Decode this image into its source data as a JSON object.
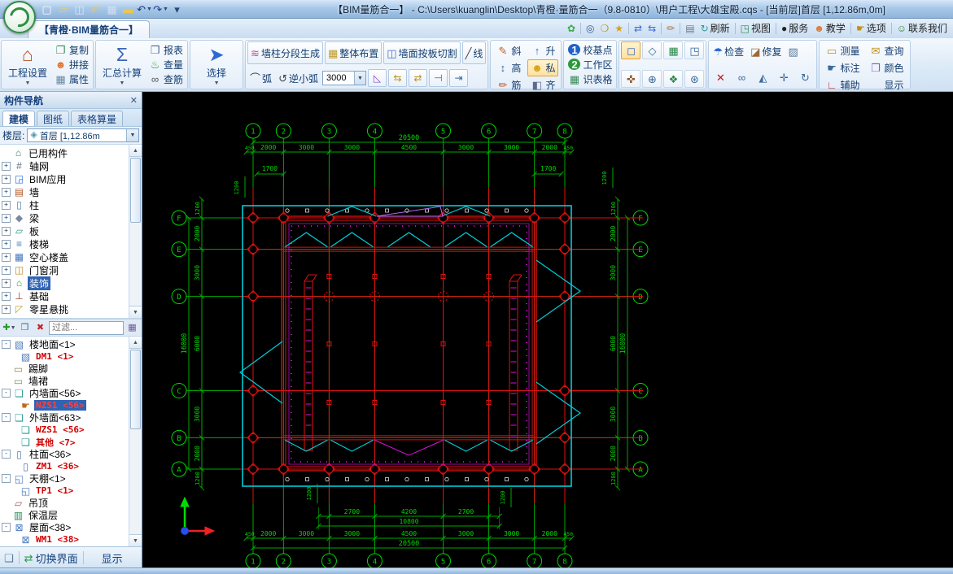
{
  "titlebar": {
    "title": "【BIM量筋合一】 - C:\\Users\\kuanglin\\Desktop\\青橙·量筋合一（9.8-0810）\\用户工程\\大雄宝殿.cqs - [当前层]首层 [1,12.86m,0m]",
    "items": [
      {
        "icon": "tnew"
      },
      {
        "icon": "topen"
      },
      {
        "icon": "tsave"
      },
      {
        "icon": "treport"
      },
      {
        "icon": "tgrid"
      },
      {
        "icon": "truler"
      },
      {
        "icon": "undo",
        "dd": true
      },
      {
        "icon": "redo",
        "dd": true
      },
      {
        "icon": "tmore"
      }
    ]
  },
  "ribbon": {
    "tab": "【青橙·BIM量筋合一】",
    "quickbar": [
      {
        "icon": "flower"
      },
      {
        "sep": true
      },
      {
        "icon": "find"
      },
      {
        "icon": "findf"
      },
      {
        "icon": "findg"
      },
      {
        "sep": true
      },
      {
        "icon": "swapa"
      },
      {
        "icon": "swapb"
      },
      {
        "sep": true
      },
      {
        "icon": "brush"
      },
      {
        "sep": true
      },
      {
        "icon": "kbd"
      },
      {
        "icon": "refresh",
        "label": "刷新"
      },
      {
        "sep": true
      },
      {
        "icon": "tv",
        "label": "视图"
      },
      {
        "sep": true
      },
      {
        "icon": "qq",
        "label": "服务"
      },
      {
        "icon": "teach",
        "label": "教学"
      },
      {
        "sep": true
      },
      {
        "icon": "opts",
        "label": "选项"
      },
      {
        "sep": true
      },
      {
        "icon": "contact",
        "label": "联系我们"
      }
    ],
    "groups": [
      {
        "t": "bigstack",
        "big": {
          "icon": "house",
          "label": "工程设置"
        },
        "stack": [
          {
            "icon": "copy",
            "label": "复制"
          },
          {
            "icon": "people2",
            "label": "拼接"
          },
          {
            "icon": "props",
            "label": "属性"
          }
        ]
      },
      {
        "t": "bigstack",
        "big": {
          "icon": "sigma",
          "label": "汇总计算"
        },
        "stack": [
          {
            "icon": "report",
            "label": "报表"
          },
          {
            "icon": "teapot",
            "label": "查量"
          },
          {
            "icon": "glasses",
            "label": "查筋"
          }
        ]
      },
      {
        "t": "big",
        "big": {
          "icon": "cursor",
          "label": "选择"
        }
      },
      {
        "t": "wall",
        "row1": [
          {
            "icon": "wallgen",
            "label": "墙柱分段生成"
          },
          {
            "icon": "layout",
            "label": "整体布置"
          },
          {
            "icon": "cutwall",
            "label": "墙面按板切割"
          },
          {
            "icon": "line",
            "label": "线"
          }
        ],
        "row2": [
          {
            "icon": "arc",
            "label": "弧"
          },
          {
            "icon": "arcr",
            "label": "逆小弧"
          }
        ],
        "combo": "3000",
        "tools": [
          "tri",
          "pairL",
          "pairR",
          "ext1",
          "ext2"
        ]
      },
      {
        "t": "grid",
        "items": [
          {
            "icon": "pencil",
            "label": "斜"
          },
          {
            "icon": "up",
            "label": "升"
          },
          {
            "icon": "height",
            "label": "高"
          },
          {
            "icon": "person",
            "label": "私",
            "hl": true
          },
          {
            "icon": "rebar",
            "label": "筋"
          },
          {
            "icon": "align",
            "label": "齐"
          }
        ]
      },
      {
        "t": "stack",
        "items": [
          {
            "icon": "b1",
            "label": "校基点"
          },
          {
            "icon": "b2",
            "label": "工作区"
          },
          {
            "icon": "table",
            "label": "识表格"
          }
        ]
      },
      {
        "t": "views",
        "row1": [
          {
            "icon": "v2d",
            "hl": true
          },
          {
            "icon": "v3d"
          },
          {
            "icon": "vbuild"
          },
          {
            "icon": "vbox"
          }
        ],
        "row2": [
          {
            "icon": "hand2"
          },
          {
            "icon": "zoompm"
          },
          {
            "icon": "pin"
          },
          {
            "icon": "zoomext"
          }
        ]
      },
      {
        "t": "fix",
        "row1": [
          {
            "icon": "umbrella",
            "label": "检查"
          },
          {
            "icon": "fix",
            "label": "修复"
          },
          {
            "icon": "fix2"
          }
        ],
        "row2": [
          {
            "icon": "del"
          },
          {
            "icon": "chain"
          },
          {
            "icon": "mirror"
          },
          {
            "icon": "move"
          },
          {
            "icon": "rotate"
          }
        ]
      },
      {
        "t": "grid",
        "items": [
          {
            "icon": "ruler2",
            "label": "测量"
          },
          {
            "icon": "query",
            "label": "查询"
          },
          {
            "icon": "tag",
            "label": "标注"
          },
          {
            "icon": "colorbox",
            "label": "颜色"
          },
          {
            "icon": "axis2",
            "label": "辅助"
          },
          {
            "icon": "display",
            "label": "显示"
          }
        ]
      }
    ]
  },
  "panel": {
    "title": "构件导航",
    "close_glyph": "✕",
    "tabs": [
      "建模",
      "图纸",
      "表格算量"
    ],
    "active_tab": 0,
    "floor_label": "楼层:",
    "floor_value": "首层 [1,12.86m",
    "filter_placeholder": "过滤...",
    "tree1": [
      {
        "label": "已用构件",
        "icon": "used"
      },
      {
        "label": "轴网",
        "icon": "axes",
        "exp": "+"
      },
      {
        "label": "BIM应用",
        "icon": "bim",
        "exp": "+"
      },
      {
        "label": "墙",
        "icon": "wall",
        "exp": "+"
      },
      {
        "label": "柱",
        "icon": "column",
        "exp": "+"
      },
      {
        "label": "梁",
        "icon": "beam",
        "exp": "+"
      },
      {
        "label": "板",
        "icon": "slab",
        "exp": "+"
      },
      {
        "label": "楼梯",
        "icon": "stairs",
        "exp": "+"
      },
      {
        "label": "空心楼盖",
        "icon": "hollow",
        "exp": "+"
      },
      {
        "label": "门窗洞",
        "icon": "opening",
        "exp": "+"
      },
      {
        "label": "装饰",
        "icon": "decor",
        "exp": "+",
        "selected": true
      },
      {
        "label": "基础",
        "icon": "foundation",
        "exp": "+"
      },
      {
        "label": "零星悬挑",
        "icon": "cantilever",
        "exp": "+"
      }
    ],
    "tree2": [
      {
        "label": "楼地面<1>",
        "icon": "floorface",
        "exp": "-"
      },
      {
        "label": "DM1 <1>",
        "icon": "floorface",
        "level": 1,
        "red": true
      },
      {
        "label": "踢脚",
        "icon": "skirting"
      },
      {
        "label": "墙裙",
        "icon": "dado"
      },
      {
        "label": "内墙面<56>",
        "icon": "wallface",
        "exp": "-"
      },
      {
        "label": "NZS1 <56>",
        "icon": "hand",
        "level": 1,
        "red": true,
        "selected": true
      },
      {
        "label": "外墙面<63>",
        "icon": "wallface",
        "exp": "-"
      },
      {
        "label": "WZS1 <56>",
        "icon": "wallface",
        "level": 1,
        "red": true
      },
      {
        "label": "其他 <7>",
        "icon": "wallface",
        "level": 1,
        "red": true
      },
      {
        "label": "柱面<36>",
        "icon": "colface",
        "exp": "-"
      },
      {
        "label": "ZM1 <36>",
        "icon": "colface",
        "level": 1,
        "red": true
      },
      {
        "label": "天棚<1>",
        "icon": "ceilface",
        "exp": "-"
      },
      {
        "label": "TP1 <1>",
        "icon": "ceilface",
        "level": 1,
        "red": true
      },
      {
        "label": "吊顶",
        "icon": "hangceil"
      },
      {
        "label": "保温层",
        "icon": "insul"
      },
      {
        "label": "屋面<38>",
        "icon": "roof",
        "exp": "-"
      },
      {
        "label": "WM1 <38>",
        "icon": "roof",
        "level": 1,
        "red": true
      }
    ],
    "bottom": [
      "切换界面",
      "显示"
    ]
  },
  "drawing": {
    "h_axis_labels": [
      "1",
      "2",
      "3",
      "4",
      "5",
      "6",
      "7",
      "8"
    ],
    "h_spans": [
      2000,
      3000,
      3000,
      4500,
      3000,
      3000,
      2000
    ],
    "h_span_labels": [
      "2000",
      "3000",
      "3000",
      "4500",
      "3000",
      "3000",
      "2000"
    ],
    "h_total": "20500",
    "h_end": "450",
    "v_axis_labels": [
      "A",
      "B",
      "C",
      "D",
      "E",
      "F"
    ],
    "v_spans": [
      2000,
      3000,
      6000,
      3000,
      2000
    ],
    "v_span_labels": [
      "2000",
      "3000",
      "6000",
      "3000",
      "2000"
    ],
    "v_total": "16000",
    "v_edge": "1200",
    "sub_labels": [
      "2700",
      "4200",
      "2700"
    ],
    "sub_total": "10800",
    "porch_dim": "1700",
    "offset_dim": "1200",
    "colors": {
      "grid": "#00a800",
      "text": "#00d800",
      "red": "#e01010",
      "cyan": "#00ccd8",
      "magenta": "#d812d8",
      "white": "#dedede"
    }
  },
  "icons": {
    "tnew": {
      "g": "▢",
      "c": "#f8fbff"
    },
    "topen": {
      "g": "▱",
      "c": "#eec860"
    },
    "tsave": {
      "g": "◫",
      "c": "#d8e6f8"
    },
    "treport": {
      "g": "✍",
      "c": "#d8c878"
    },
    "tgrid": {
      "g": "▦",
      "c": "#cfe0f4"
    },
    "truler": {
      "g": "▬",
      "c": "#e8c850"
    },
    "undo": {
      "g": "↶",
      "c": "#1a3a8a"
    },
    "redo": {
      "g": "↷",
      "c": "#1a3a8a"
    },
    "tmore": {
      "g": "▾",
      "c": "#27497a"
    },
    "flower": {
      "g": "✿",
      "c": "#3aae49"
    },
    "find": {
      "g": "◎",
      "c": "#3a5a8a"
    },
    "findf": {
      "g": "❍",
      "c": "#c0901a"
    },
    "findg": {
      "g": "★",
      "c": "#d4a017"
    },
    "swapa": {
      "g": "⇄",
      "c": "#3a6ad4"
    },
    "swapb": {
      "g": "⇆",
      "c": "#3a6ad4"
    },
    "brush": {
      "g": "✏",
      "c": "#b0703a"
    },
    "kbd": {
      "g": "▤",
      "c": "#6a7a8a"
    },
    "refresh": {
      "g": "↻",
      "c": "#2a9a9a"
    },
    "tv": {
      "g": "◳",
      "c": "#2a8a4a"
    },
    "qq": {
      "g": "●",
      "c": "#222222"
    },
    "teach": {
      "g": "☻",
      "c": "#e07830"
    },
    "opts": {
      "g": "☛",
      "c": "#c0901a"
    },
    "contact": {
      "g": "☺",
      "c": "#3a8a3a"
    },
    "house": {
      "g": "⌂",
      "c": "#b0502a"
    },
    "sigma": {
      "g": "Σ",
      "c": "#3a66b8"
    },
    "cursor": {
      "g": "➤",
      "c": "#2a6ad4"
    },
    "copy": {
      "g": "❐",
      "c": "#3a8a5a"
    },
    "people2": {
      "g": "☻",
      "c": "#e07830"
    },
    "props": {
      "g": "▦",
      "c": "#6a8aa0"
    },
    "report": {
      "g": "❒",
      "c": "#4a6a9a"
    },
    "teapot": {
      "g": "♨",
      "c": "#2a9a2a"
    },
    "glasses": {
      "g": "∞",
      "c": "#555555"
    },
    "wallgen": {
      "g": "≋",
      "c": "#c04a9a"
    },
    "layout": {
      "g": "▦",
      "c": "#c09a2a"
    },
    "cutwall": {
      "g": "◫",
      "c": "#4a6ac0"
    },
    "line": {
      "g": "╱",
      "c": "#444444"
    },
    "arc": {
      "g": "⌒",
      "c": "#444444"
    },
    "arcr": {
      "g": "↺",
      "c": "#444444"
    },
    "tri": {
      "g": "◺",
      "c": "#8a4ac0"
    },
    "pairL": {
      "g": "⇆",
      "c": "#c0901a"
    },
    "pairR": {
      "g": "⇄",
      "c": "#c0901a"
    },
    "ext1": {
      "g": "⊣",
      "c": "#3a6a9a"
    },
    "ext2": {
      "g": "⇥",
      "c": "#3a6a9a"
    },
    "pencil": {
      "g": "✎",
      "c": "#c05a2a"
    },
    "up": {
      "g": "↑",
      "c": "#2a6ad4"
    },
    "height": {
      "g": "↕",
      "c": "#3a6a9a"
    },
    "person": {
      "g": "☻",
      "c": "#d4a017"
    },
    "rebar": {
      "g": "✏",
      "c": "#c05a2a"
    },
    "align": {
      "g": "◧",
      "c": "#5a6a8a"
    },
    "b1": {
      "badge": true,
      "bg": "#1f62c8",
      "c": "#ffffff",
      "g": "1"
    },
    "b2": {
      "badge": true,
      "bg": "#2a9a3a",
      "c": "#ffffff",
      "g": "2"
    },
    "table": {
      "g": "▦",
      "c": "#3a8a5a"
    },
    "v2d": {
      "g": "◻",
      "c": "#3a6ac0"
    },
    "v3d": {
      "g": "◇",
      "c": "#3a6a9a"
    },
    "vbuild": {
      "g": "▦",
      "c": "#2a8a4a"
    },
    "vbox": {
      "g": "◳",
      "c": "#3a6a9a"
    },
    "hand2": {
      "g": "✜",
      "c": "#8a5a2a"
    },
    "zoompm": {
      "g": "⊕",
      "c": "#3a6a9a"
    },
    "pin": {
      "g": "❖",
      "c": "#2a8a4a"
    },
    "zoomext": {
      "g": "⊛",
      "c": "#3a6a9a"
    },
    "umbrella": {
      "g": "☂",
      "c": "#2a6ad4"
    },
    "fix": {
      "g": "◪",
      "c": "#9a6a3a"
    },
    "fix2": {
      "g": "▨",
      "c": "#5a7a9a"
    },
    "del": {
      "g": "✕",
      "c": "#cc1111"
    },
    "chain": {
      "g": "∞",
      "c": "#3a6a9a"
    },
    "mirror": {
      "g": "◭",
      "c": "#3a6a9a"
    },
    "move": {
      "g": "✛",
      "c": "#3a6a9a"
    },
    "rotate": {
      "g": "↻",
      "c": "#3a6a9a"
    },
    "ruler2": {
      "g": "▭",
      "c": "#c0901a"
    },
    "query": {
      "g": "✉",
      "c": "#c0901a"
    },
    "tag": {
      "g": "☛",
      "c": "#3a6a9a"
    },
    "colorbox": {
      "g": "❒",
      "c": "#8a5ac0"
    },
    "axis2": {
      "g": "∟",
      "c": "#c03a3a"
    },
    "display": {
      "quad": [
        "#e03030",
        "#2fa030",
        "#3a64d8",
        "#e8a81e"
      ]
    },
    "used": {
      "g": "⌂",
      "c": "#2e8b57"
    },
    "axes": {
      "g": "#",
      "c": "#607080"
    },
    "bim": {
      "g": "◲",
      "c": "#2a6ad4"
    },
    "wall": {
      "g": "▤",
      "c": "#b05a2a"
    },
    "column": {
      "g": "▯",
      "c": "#4a7ab0"
    },
    "beam": {
      "g": "◆",
      "c": "#7a8aa0"
    },
    "slab": {
      "g": "▱",
      "c": "#3a9a8a"
    },
    "stairs": {
      "g": "≡",
      "c": "#4a7ac0"
    },
    "hollow": {
      "g": "▦",
      "c": "#4a7ac0"
    },
    "opening": {
      "g": "◫",
      "c": "#c08020"
    },
    "decor": {
      "g": "⌂",
      "c": "#3a9a3a"
    },
    "foundation": {
      "g": "⊥",
      "c": "#a04a3a"
    },
    "cantilever": {
      "g": "◸",
      "c": "#c0a020"
    },
    "floorface": {
      "g": "▧",
      "c": "#4a7ac0"
    },
    "skirting": {
      "g": "▭",
      "c": "#8a8a5a"
    },
    "dado": {
      "g": "▭",
      "c": "#6a9a5a"
    },
    "wallface": {
      "g": "❏",
      "c": "#2a9a9a"
    },
    "hand": {
      "g": "☛",
      "c": "#c06a1a"
    },
    "colface": {
      "g": "▯",
      "c": "#4a7ab0"
    },
    "ceilface": {
      "g": "◱",
      "c": "#4a7ac0"
    },
    "hangceil": {
      "g": "▱",
      "c": "#a05a5a"
    },
    "insul": {
      "g": "▥",
      "c": "#2a8a5a"
    },
    "roof": {
      "g": "⊠",
      "c": "#4a7ac0"
    },
    "flayer": {
      "g": "◈",
      "c": "#4a9ab0"
    },
    "padd": {
      "g": "✚",
      "c": "#2a9a2a"
    },
    "pcopy": {
      "g": "❐",
      "c": "#3a6a9a"
    },
    "pdel": {
      "g": "✖",
      "c": "#cc2222"
    },
    "pgrid": {
      "g": "▦",
      "c": "#6a5a9a"
    },
    "playeri": {
      "g": "❏",
      "c": "#5a7a9a"
    },
    "pswap": {
      "g": "⇄",
      "c": "#2a9a4a"
    }
  }
}
